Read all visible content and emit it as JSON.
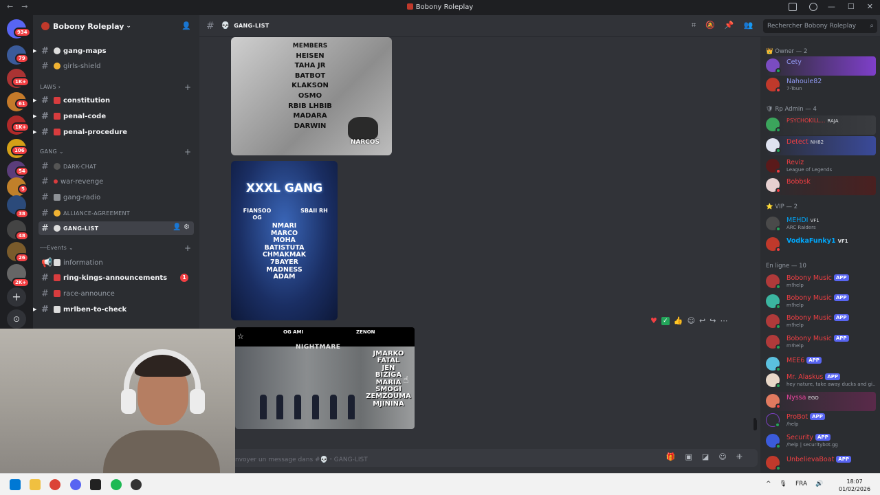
{
  "window": {
    "title": "Bobony Roleplay"
  },
  "rail": {
    "badges": [
      "934",
      "79",
      "1K+",
      "61",
      "1K+",
      "106",
      "54",
      "5",
      "38",
      "48",
      "26",
      "2K+"
    ],
    "add_label": "+",
    "discover_label": "⊙"
  },
  "server": {
    "name": "Bobony Roleplay"
  },
  "sidebar": {
    "top_channels": [
      {
        "name": "gang-maps",
        "emoji": "💀"
      },
      {
        "name": "girls-shield",
        "emoji": "😊"
      }
    ],
    "laws_category": "LAWS",
    "laws": [
      {
        "name": "constitution"
      },
      {
        "name": "penal-code"
      },
      {
        "name": "penal-procedure"
      }
    ],
    "gang_category": "GANG",
    "gang": [
      {
        "name": "DARK-CHAT"
      },
      {
        "name": "war-revenge"
      },
      {
        "name": "gang-radio"
      },
      {
        "name": "ALLIANCE-AGREEMENT"
      },
      {
        "name": "GANG-LIST"
      }
    ],
    "events_category": "Events",
    "events": [
      {
        "name": "information"
      },
      {
        "name": "ring-kings-announcements",
        "count": "1"
      },
      {
        "name": "race-announce"
      },
      {
        "name": "mrlben-to-check"
      }
    ]
  },
  "header": {
    "channel": "GANG-LIST",
    "search_placeholder": "Rechercher Bobony Roleplay"
  },
  "messages": {
    "image1": {
      "header": "MEMBERS",
      "names": [
        "HEISEN",
        "TAHA JR",
        "BATBOT",
        "KLAKSON",
        "OSMO",
        "RBIB LHBIB",
        "MADARA",
        "DARWIN"
      ],
      "brand": "NARCOS"
    },
    "image2": {
      "title": "XXXL GANG",
      "left": "FIANSOO OG",
      "right": "SBAII RH",
      "names": [
        "NMARI",
        "MARCO",
        "MOHA",
        "BATISTUTA",
        "CHMAKMAK",
        "7BAYER",
        "MADNESS",
        "ADAM"
      ]
    },
    "image3": {
      "og": "OG AMI",
      "zenon": "ZENON",
      "title": "NIGHTMARE",
      "names": [
        "JMARKO",
        "FATAL",
        "JEN",
        "BIZIGA",
        "MARIA",
        "SMOGI",
        "ZEMZOUMA",
        "MJININA"
      ]
    },
    "composer_placeholder": "nvoyer un message dans #💀・GANG-LIST"
  },
  "members": {
    "owner_category": "Owner — 2",
    "owners": [
      {
        "name": "Cety",
        "color": "#949cf7",
        "sub": ""
      },
      {
        "name": "Nahoule82",
        "color": "#949cf7",
        "sub": "7-Toun"
      }
    ],
    "admin_category": "Rp Admin — 4",
    "admins": [
      {
        "name": "PSYCHOKILL...",
        "color": "#f23f43",
        "sub": "",
        "tag": "RAJA"
      },
      {
        "name": "Detect",
        "color": "#f23f43",
        "sub": "",
        "tag": "NH82"
      },
      {
        "name": "Reviz",
        "color": "#f23f43",
        "sub": "League of Legends",
        "tag": ""
      },
      {
        "name": "Bobbsk",
        "color": "#f23f43",
        "sub": "",
        "tag": ""
      }
    ],
    "vip_category": "VIP — 2",
    "vips": [
      {
        "name": "MEHDI",
        "color": "#00a8fc",
        "sub": "ARC Raiders",
        "tag": "VF1"
      },
      {
        "name": "VodkaFunky1",
        "color": "#00a8fc",
        "sub": "",
        "tag": "VF1"
      }
    ],
    "online_category": "En ligne — 10",
    "online": [
      {
        "name": "Bobony Music",
        "color": "#f23f43",
        "sub": "m!help",
        "tag": "APP"
      },
      {
        "name": "Bobony Music",
        "color": "#f23f43",
        "sub": "m!help",
        "tag": "APP"
      },
      {
        "name": "Bobony Music",
        "color": "#f23f43",
        "sub": "m!help",
        "tag": "APP"
      },
      {
        "name": "Bobony Music",
        "color": "#f23f43",
        "sub": "m!help",
        "tag": "APP"
      },
      {
        "name": "MEE6",
        "color": "#f23f43",
        "sub": "",
        "tag": "APP"
      },
      {
        "name": "Mr. Alaskus",
        "color": "#f23f43",
        "sub": "hey nature, take away ducks and gi...",
        "tag": "APP"
      },
      {
        "name": "Nyssa",
        "color": "#eb459e",
        "sub": "",
        "tag": "EGO"
      },
      {
        "name": "ProBot",
        "color": "#f23f43",
        "sub": "/help",
        "tag": "APP"
      },
      {
        "name": "Security",
        "color": "#f23f43",
        "sub": "/help | securitybot.gg",
        "tag": "APP"
      },
      {
        "name": "UnbelievaBoat",
        "color": "#f23f43",
        "sub": "",
        "tag": "APP"
      }
    ]
  },
  "taskbar": {
    "lang": "FRA",
    "time": "18:07",
    "date": "01/02/2026"
  }
}
